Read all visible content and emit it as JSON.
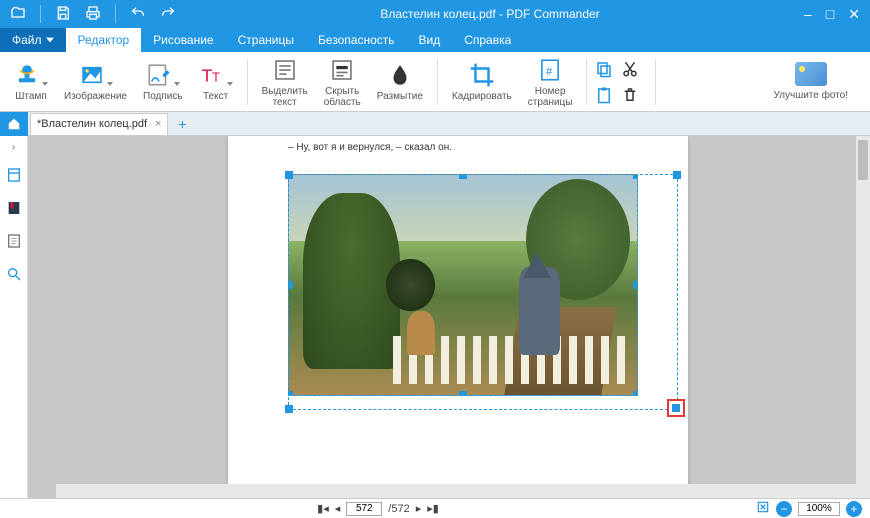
{
  "window": {
    "title": "Властелин колец.pdf - PDF Commander"
  },
  "menu": {
    "file": "Файл",
    "editor": "Редактор",
    "drawing": "Рисование",
    "pages": "Страницы",
    "security": "Безопасность",
    "view": "Вид",
    "help": "Справка"
  },
  "ribbon": {
    "stamp": "Штамп",
    "image": "Изображение",
    "signature": "Подпись",
    "text": "Текст",
    "highlight": "Выделить\nтекст",
    "hide_area": "Скрыть\nобласть",
    "blur": "Размытие",
    "crop": "Кадрировать",
    "page_number": "Номер\nстраницы",
    "improve": "Улучшите фото!"
  },
  "tabs": {
    "doc": "*Властелин колец.pdf"
  },
  "page": {
    "text_line": "– Ну, вот я и вернулся, – сказал он."
  },
  "pager": {
    "current": "572",
    "total": "/572"
  },
  "zoom": {
    "value": "100%"
  }
}
